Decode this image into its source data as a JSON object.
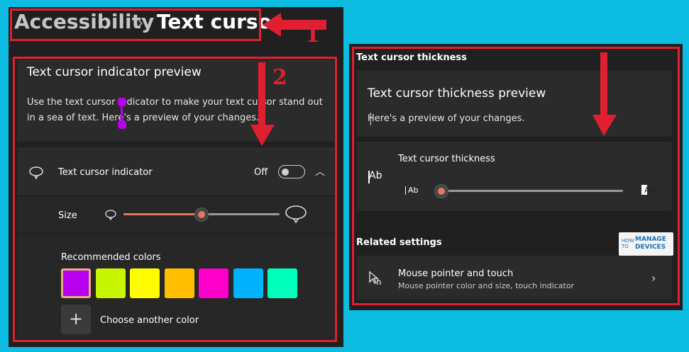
{
  "breadcrumb": {
    "parent": "Accessibility",
    "separator": "›",
    "current": "Text cursor"
  },
  "left": {
    "preview_title": "Text cursor indicator preview",
    "preview_description": "Use the text cursor indicator to make your text cursor stand out in a sea of text. Here's a preview of your changes.",
    "indicator_label": "Text cursor indicator",
    "indicator_state": "Off",
    "size_label": "Size",
    "size_value": 0.5,
    "recommended_colors_label": "Recommended colors",
    "colors": [
      "#b800ee",
      "#c8f500",
      "#fffc00",
      "#ffbf00",
      "#ff00cc",
      "#00b3ff",
      "#00ffbb"
    ],
    "selected_color_index": 0,
    "choose_color_label": "Choose another color"
  },
  "right": {
    "section_title": "Text cursor thickness",
    "preview_title": "Text cursor thickness preview",
    "preview_description": "Here's a preview of your changes.",
    "thickness_label": "Text cursor thickness",
    "thickness_value": 0.0,
    "ab_text": "Ab",
    "related_settings_label": "Related settings",
    "mouse_pointer_title": "Mouse pointer and touch",
    "mouse_pointer_subtitle": "Mouse pointer color and size, touch indicator"
  },
  "logo": {
    "how": "HOW TO",
    "line1": "MANAGE",
    "line2": "DEVICES"
  },
  "annotations": {
    "step1": "1",
    "step2": "2",
    "color": "#e02030"
  },
  "colors": {
    "accent": "#e07a62",
    "background": "#0cbde1"
  }
}
